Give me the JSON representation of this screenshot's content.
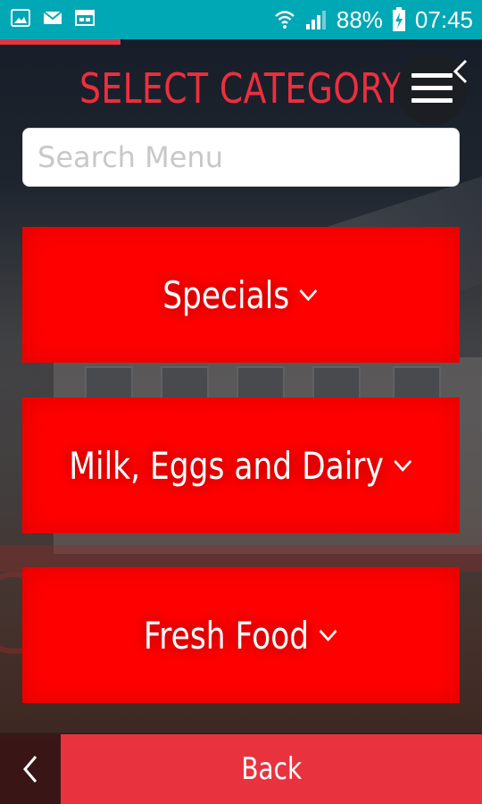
{
  "status_bar": {
    "battery": "88%",
    "time": "07:45",
    "icons": [
      "gallery-icon",
      "mail-icon",
      "calendar-icon",
      "wifi-icon",
      "signal-icon",
      "battery-icon"
    ]
  },
  "header": {
    "title": "SELECT CATEGORY"
  },
  "search": {
    "placeholder": "Search Menu",
    "value": ""
  },
  "categories": [
    {
      "label": "Specials"
    },
    {
      "label": "Milk, Eggs and Dairy"
    },
    {
      "label": "Fresh Food"
    }
  ],
  "footer": {
    "back_label": "Back"
  },
  "colors": {
    "status_bar": "#00a7b5",
    "accent": "#e8333f",
    "category_bg": "#ff0000"
  }
}
